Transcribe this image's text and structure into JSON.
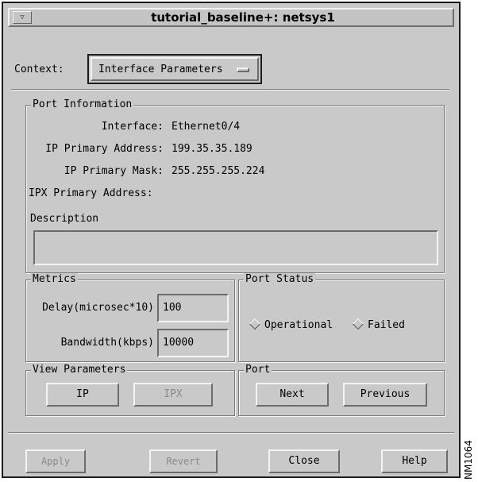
{
  "window": {
    "title": "tutorial_baseline+: netsys1",
    "menu_glyph": "▽"
  },
  "context": {
    "label": "Context:",
    "value": "Interface Parameters"
  },
  "port_information": {
    "title": "Port Information",
    "fields": [
      {
        "label": "Interface:",
        "value": "Ethernet0/4"
      },
      {
        "label": "IP Primary Address:",
        "value": "199.35.35.189"
      },
      {
        "label": "IP Primary Mask:",
        "value": "255.255.255.224"
      },
      {
        "label": "IPX Primary Address:",
        "value": ""
      }
    ],
    "description_label": "Description",
    "description_value": ""
  },
  "metrics": {
    "title": "Metrics",
    "delay_label": "Delay(microsec*10)",
    "delay_value": "100",
    "bandwidth_label": "Bandwidth(kbps)",
    "bandwidth_value": "10000"
  },
  "port_status": {
    "title": "Port Status",
    "options": [
      "Operational",
      "Failed"
    ]
  },
  "view_parameters": {
    "title": "View Parameters",
    "ip_label": "IP",
    "ipx_label": "IPX",
    "ipx_enabled": false
  },
  "port": {
    "title": "Port",
    "next_label": "Next",
    "previous_label": "Previous"
  },
  "footer": {
    "apply_label": "Apply",
    "revert_label": "Revert",
    "close_label": "Close",
    "help_label": "Help",
    "apply_enabled": false,
    "revert_enabled": false
  },
  "figure_code": "NM1064",
  "colors": {
    "window_bg": "#c9c9c9",
    "bevel_light": "#f4f4f4",
    "bevel_dark": "#6c6c6c",
    "disabled_text": "#8a8a8a"
  }
}
